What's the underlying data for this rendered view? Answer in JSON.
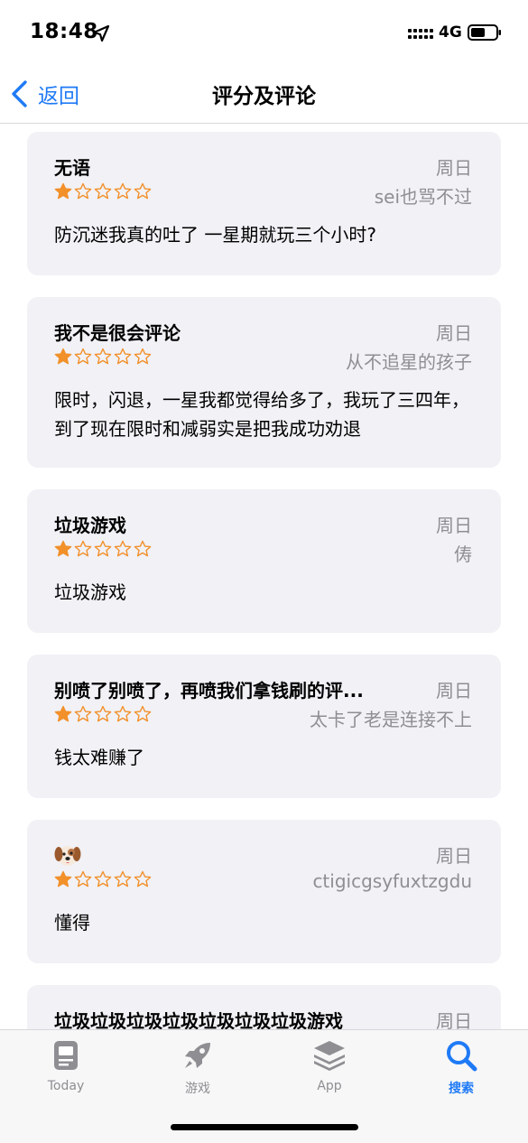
{
  "status_bar": {
    "time": "18:48",
    "network": "4G"
  },
  "nav": {
    "back_label": "返回",
    "title": "评分及评论"
  },
  "colors": {
    "accent": "#1f7af6",
    "star": "#f2902a",
    "card_bg": "#f1f1f6",
    "secondary_text": "#8e8e93"
  },
  "reviews": [
    {
      "title": "无语",
      "date": "周日",
      "stars": 1,
      "author": "sei也骂不过",
      "body": "防沉迷我真的吐了 一星期就玩三个小时?"
    },
    {
      "title": "我不是很会评论",
      "date": "周日",
      "stars": 1,
      "author": "从不追星的孩子",
      "body": "限时，闪退，一星我都觉得给多了，我玩了三四年，到了现在限时和减弱实是把我成功劝退"
    },
    {
      "title": "垃圾游戏",
      "date": "周日",
      "stars": 1,
      "author": "俦",
      "body": "垃圾游戏"
    },
    {
      "title": "别喷了别喷了，再喷我们拿钱刷的评...",
      "date": "周日",
      "stars": 1,
      "author": "太卡了老是连接不上",
      "body": "钱太难赚了"
    },
    {
      "title_icon": "dog-face-emoji",
      "date": "周日",
      "stars": 1,
      "author": "ctigicgsyfuxtzgdu",
      "body": "懂得"
    },
    {
      "title": "垃圾垃圾垃圾垃圾垃圾垃圾垃圾游戏",
      "date": "周日"
    }
  ],
  "tabs": [
    {
      "label": "Today",
      "icon": "today-icon"
    },
    {
      "label": "游戏",
      "icon": "rocket-icon"
    },
    {
      "label": "App",
      "icon": "app-stack-icon"
    },
    {
      "label": "搜索",
      "icon": "search-icon",
      "active": true
    }
  ]
}
